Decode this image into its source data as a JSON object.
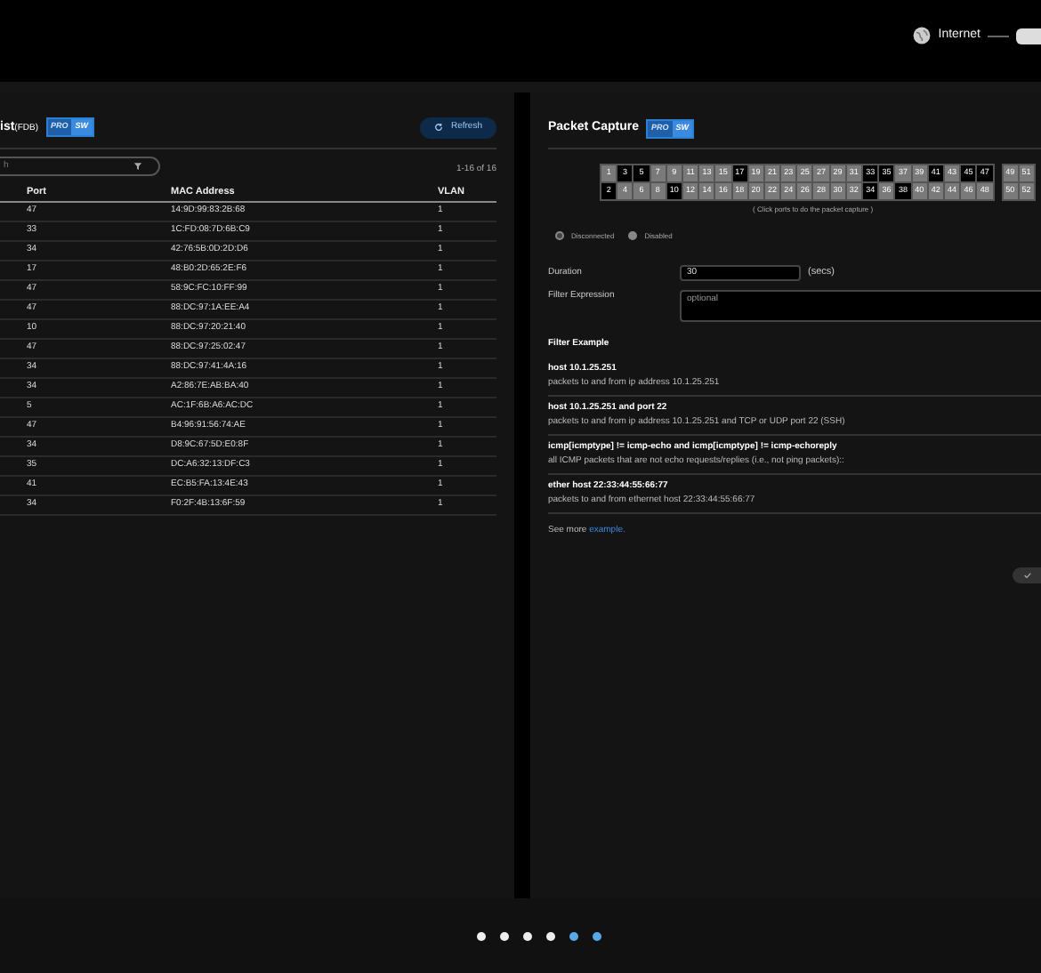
{
  "header": {
    "internet_label": "Internet"
  },
  "fdb_panel": {
    "title": "ist",
    "title_suffix": "(FDB)",
    "badge": [
      "PRO",
      "SW"
    ],
    "search": {
      "placeholder": "h"
    },
    "refresh_button": "Refresh",
    "range": "1-16 of 16",
    "table": {
      "columns": [
        "Port",
        "MAC Address",
        "VLAN"
      ],
      "rows": [
        [
          "47",
          "14:9D:99:83:2B:68",
          "1"
        ],
        [
          "33",
          "1C:FD:08:7D:6B:C9",
          "1"
        ],
        [
          "34",
          "42:76:5B:0D:2D:D6",
          "1"
        ],
        [
          "17",
          "48:B0:2D:65:2E:F6",
          "1"
        ],
        [
          "47",
          "58:9C:FC:10:FF:99",
          "1"
        ],
        [
          "47",
          "88:DC:97:1A:EE:A4",
          "1"
        ],
        [
          "10",
          "88:DC:97:20:21:40",
          "1"
        ],
        [
          "47",
          "88:DC:97:25:02:47",
          "1"
        ],
        [
          "34",
          "88:DC:97:41:4A:16",
          "1"
        ],
        [
          "34",
          "A2:86:7E:AB:BA:40",
          "1"
        ],
        [
          "5",
          "AC:1F:6B:A6:AC:DC",
          "1"
        ],
        [
          "47",
          "B4:96:91:56:74:AE",
          "1"
        ],
        [
          "34",
          "D8:9C:67:5D:E0:8F",
          "1"
        ],
        [
          "35",
          "DC:A6:32:13:DF:C3",
          "1"
        ],
        [
          "41",
          "EC:B5:FA:13:4E:43",
          "1"
        ],
        [
          "34",
          "F0:2F:4B:13:6F:59",
          "1"
        ]
      ]
    }
  },
  "capture_panel": {
    "title": "Packet Capture",
    "badge": [
      "PRO",
      "SW"
    ],
    "port_groups": [
      {
        "top": [
          {
            "label": "1",
            "connected": false
          },
          {
            "label": "3",
            "connected": true
          },
          {
            "label": "5",
            "connected": true
          },
          {
            "label": "7",
            "connected": false
          },
          {
            "label": "9",
            "connected": false
          },
          {
            "label": "11",
            "connected": false
          },
          {
            "label": "13",
            "connected": false
          },
          {
            "label": "15",
            "connected": false
          },
          {
            "label": "17",
            "connected": true
          },
          {
            "label": "19",
            "connected": false
          },
          {
            "label": "21",
            "connected": false
          },
          {
            "label": "23",
            "connected": false
          },
          {
            "label": "25",
            "connected": false
          },
          {
            "label": "27",
            "connected": false
          },
          {
            "label": "29",
            "connected": false
          },
          {
            "label": "31",
            "connected": false
          },
          {
            "label": "33",
            "connected": true
          },
          {
            "label": "35",
            "connected": true
          },
          {
            "label": "37",
            "connected": false
          },
          {
            "label": "39",
            "connected": false
          },
          {
            "label": "41",
            "connected": true
          },
          {
            "label": "43",
            "connected": false
          },
          {
            "label": "45",
            "connected": true
          },
          {
            "label": "47",
            "connected": true
          }
        ],
        "bottom": [
          {
            "label": "2",
            "connected": true
          },
          {
            "label": "4",
            "connected": false
          },
          {
            "label": "6",
            "connected": false
          },
          {
            "label": "8",
            "connected": false
          },
          {
            "label": "10",
            "connected": true
          },
          {
            "label": "12",
            "connected": false
          },
          {
            "label": "14",
            "connected": false
          },
          {
            "label": "16",
            "connected": false
          },
          {
            "label": "18",
            "connected": false
          },
          {
            "label": "20",
            "connected": false
          },
          {
            "label": "22",
            "connected": false
          },
          {
            "label": "24",
            "connected": false
          },
          {
            "label": "26",
            "connected": false
          },
          {
            "label": "28",
            "connected": false
          },
          {
            "label": "30",
            "connected": false
          },
          {
            "label": "32",
            "connected": false
          },
          {
            "label": "34",
            "connected": true
          },
          {
            "label": "36",
            "connected": false
          },
          {
            "label": "38",
            "connected": true
          },
          {
            "label": "40",
            "connected": false
          },
          {
            "label": "42",
            "connected": false
          },
          {
            "label": "44",
            "connected": false
          },
          {
            "label": "46",
            "connected": false
          },
          {
            "label": "48",
            "connected": false
          }
        ]
      },
      {
        "top": [
          {
            "label": "49",
            "connected": false
          },
          {
            "label": "51",
            "connected": false
          }
        ],
        "bottom": [
          {
            "label": "50",
            "connected": false
          },
          {
            "label": "52",
            "connected": false
          }
        ]
      }
    ],
    "hint": "( Click ports to do the packet capture )",
    "legend": [
      {
        "label": "Disconnected",
        "kind": "disconnected"
      },
      {
        "label": "Disabled",
        "kind": "disabled"
      }
    ],
    "duration": {
      "label": "Duration",
      "value": "30",
      "unit": "(secs)"
    },
    "filter": {
      "label": "Filter Expression",
      "placeholder": "optional"
    },
    "examples_title": "Filter Example",
    "examples": [
      {
        "expression": "host 10.1.25.251",
        "description": "packets to and from ip address 10.1.25.251"
      },
      {
        "expression": "host 10.1.25.251 and port 22",
        "description": "packets to and from ip address 10.1.25.251 and TCP or UDP port 22 (SSH)"
      },
      {
        "expression": "icmp[icmptype] != icmp-echo and icmp[icmptype] != icmp-echoreply",
        "description": "all ICMP packets that are not echo requests/replies (i.e., not ping packets)::"
      },
      {
        "expression": "ether host 22:33:44:55:66:77",
        "description": "packets to and from ethernet host 22:33:44:55:66:77"
      }
    ],
    "see_more": {
      "text": "See more",
      "link": "example."
    }
  },
  "carousel": {
    "dots": [
      {
        "selected": false
      },
      {
        "selected": false
      },
      {
        "selected": false
      },
      {
        "selected": false
      },
      {
        "selected": true
      },
      {
        "selected": true
      }
    ]
  }
}
